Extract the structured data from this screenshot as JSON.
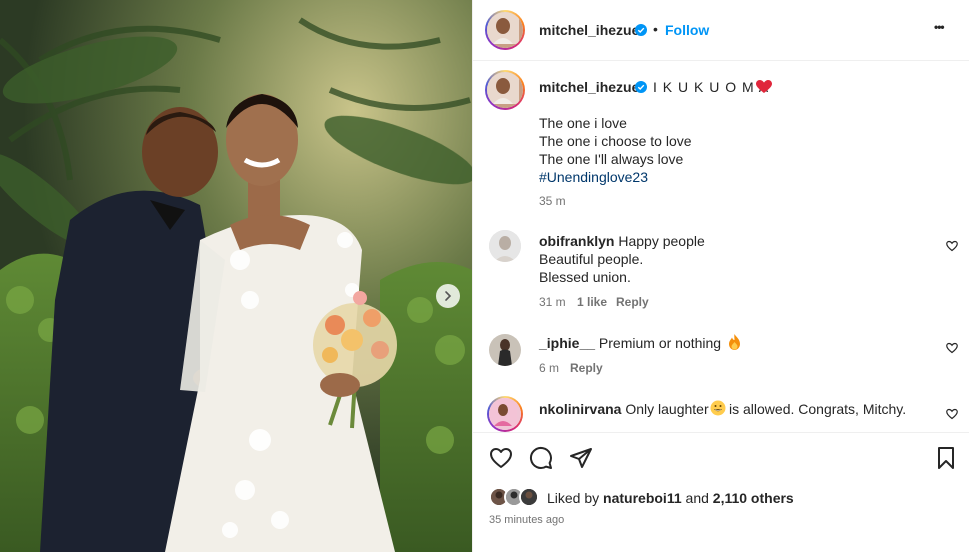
{
  "post": {
    "username": "mitchel_ihezue",
    "follow_label": "Follow",
    "separator": "•",
    "more_label": "•••"
  },
  "caption": {
    "username": "mitchel_ihezue",
    "headline": "I K U K U O M A",
    "lines": [
      "The one i love",
      "The one i choose to love",
      "The one I'll always love"
    ],
    "hashtag": "#Unendinglove23",
    "time": "35 m"
  },
  "comments": [
    {
      "username": "obifranklyn",
      "lines": [
        "Happy people",
        "Beautiful people.",
        "Blessed union."
      ],
      "time": "31 m",
      "likes": "1 like",
      "reply": "Reply"
    },
    {
      "username": "_iphie__",
      "text": "Premium or nothing",
      "time": "6 m",
      "reply": "Reply"
    },
    {
      "username": "nkolinirvana",
      "text_before": "Only laughter",
      "text_after": "is allowed. Congrats, Mitchy."
    }
  ],
  "likes": {
    "prefix": "Liked by",
    "user": "natureboi11",
    "middle": "and",
    "others": "2,110 others"
  },
  "timestamp": "35 minutes ago",
  "colors": {
    "accent": "#0095f6",
    "hashtag": "#00376b",
    "muted": "#737373",
    "heart": "#ed4956"
  },
  "icons": {
    "like": "heart-icon",
    "comment": "comment-icon",
    "share": "paper-plane-icon",
    "save": "bookmark-icon",
    "next": "chevron-right-icon"
  }
}
